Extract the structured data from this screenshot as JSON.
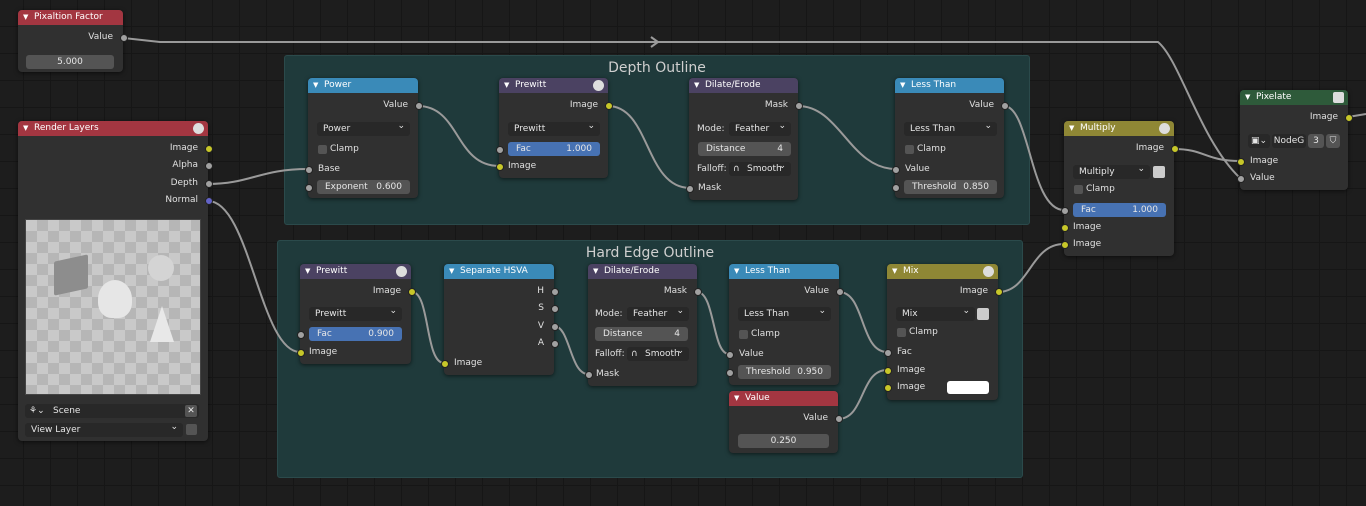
{
  "frames": {
    "depth_outline": "Depth Outline",
    "hard_edge_outline": "Hard Edge Outline"
  },
  "pixelation_factor": {
    "title": "Pixaltion Factor",
    "output": "Value",
    "value": "5.000"
  },
  "render_layers": {
    "title": "Render Layers",
    "outputs": [
      "Image",
      "Alpha",
      "Depth",
      "Normal"
    ],
    "scene": "Scene",
    "view_layer": "View Layer"
  },
  "power": {
    "title": "Power",
    "output": "Value",
    "operation": "Power",
    "clamp": "Clamp",
    "base": "Base",
    "exponent_label": "Exponent",
    "exponent_value": "0.600"
  },
  "prewitt_1": {
    "title": "Prewitt",
    "output": "Image",
    "filter": "Prewitt",
    "fac_label": "Fac",
    "fac_value": "1.000",
    "input": "Image"
  },
  "dilate_1": {
    "title": "Dilate/Erode",
    "output": "Mask",
    "mode_label": "Mode:",
    "mode": "Feather",
    "distance_label": "Distance",
    "distance_value": "4",
    "falloff_label": "Falloff:",
    "falloff": "Smooth",
    "input": "Mask"
  },
  "less_than_1": {
    "title": "Less Than",
    "output": "Value",
    "operation": "Less Than",
    "clamp": "Clamp",
    "input": "Value",
    "threshold_label": "Threshold",
    "threshold_value": "0.850"
  },
  "multiply": {
    "title": "Multiply",
    "output": "Image",
    "blend": "Multiply",
    "clamp": "Clamp",
    "fac_label": "Fac",
    "fac_value": "1.000",
    "inputs": [
      "Image",
      "Image"
    ]
  },
  "pixelate": {
    "title": "Pixelate",
    "output": "Image",
    "node_group": "NodeG",
    "users": "3",
    "inputs": [
      "Image",
      "Value"
    ]
  },
  "prewitt_2": {
    "title": "Prewitt",
    "output": "Image",
    "filter": "Prewitt",
    "fac_label": "Fac",
    "fac_value": "0.900",
    "input": "Image"
  },
  "separate_hsva": {
    "title": "Separate HSVA",
    "outputs": [
      "H",
      "S",
      "V",
      "A"
    ],
    "input": "Image"
  },
  "dilate_2": {
    "title": "Dilate/Erode",
    "output": "Mask",
    "mode_label": "Mode:",
    "mode": "Feather",
    "distance_label": "Distance",
    "distance_value": "4",
    "falloff_label": "Falloff:",
    "falloff": "Smooth",
    "input": "Mask"
  },
  "less_than_2": {
    "title": "Less Than",
    "output": "Value",
    "operation": "Less Than",
    "clamp": "Clamp",
    "input": "Value",
    "threshold_label": "Threshold",
    "threshold_value": "0.950"
  },
  "value_node": {
    "title": "Value",
    "output": "Value",
    "value": "0.250"
  },
  "mix": {
    "title": "Mix",
    "output": "Image",
    "blend": "Mix",
    "clamp": "Clamp",
    "inputs": [
      "Fac",
      "Image",
      "Image"
    ]
  },
  "colors": {
    "input_header": "#a33641",
    "filter_header": "#4b4262",
    "converter_header": "#3a8ab8",
    "color_header": "#8f8735",
    "distort_header": "#2e5a3a",
    "frame": "#1f3a3b",
    "socket_color": "#c7c729",
    "socket_value": "#a1a1a1",
    "socket_vector": "#6363c7",
    "field_blue": "#4772b3"
  }
}
